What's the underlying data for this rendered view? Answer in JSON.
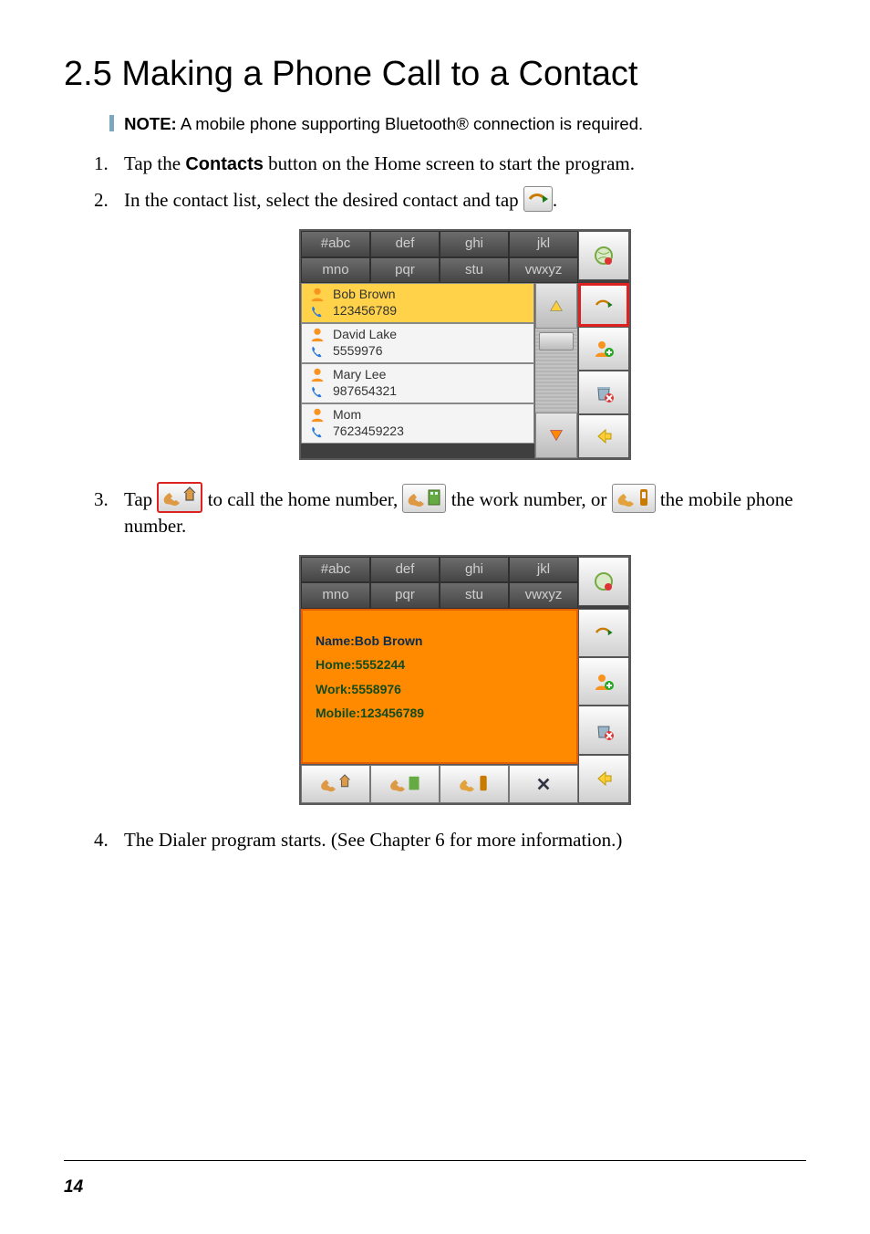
{
  "heading": "2.5   Making a Phone Call to a Contact",
  "note": {
    "label": "NOTE:",
    "text": " A mobile phone supporting Bluetooth® connection is required."
  },
  "steps": {
    "s1_prefix": "Tap the ",
    "s1_bold": "Contacts",
    "s1_suffix": " button on the Home screen to start the program.",
    "s2": "In the contact list, select the desired contact and tap ",
    "s2_end": ".",
    "s3_a": "Tap ",
    "s3_b": " to call the home number, ",
    "s3_c": " the work number, or ",
    "s3_d": " the mobile phone number.",
    "s4": "The Dialer program starts. (See Chapter 6 for more information.)"
  },
  "keypad": {
    "r1": [
      "#abc",
      "def",
      "ghi",
      "jkl"
    ],
    "r2": [
      "mno",
      "pqr",
      "stu",
      "vwxyz"
    ]
  },
  "contacts": [
    {
      "name": "Bob Brown",
      "num": "123456789",
      "selected": true
    },
    {
      "name": "David Lake",
      "num": "5559976",
      "selected": false
    },
    {
      "name": "Mary Lee",
      "num": "987654321",
      "selected": false
    },
    {
      "name": "Mom",
      "num": "7623459223",
      "selected": false
    }
  ],
  "detail": {
    "name_label": "Name:",
    "name_value": "Bob Brown",
    "home_label": "Home:",
    "home_value": "5552244",
    "work_label": "Work:",
    "work_value": "5558976",
    "mobile_label": "Mobile:",
    "mobile_value": "123456789"
  },
  "page_number": "14"
}
